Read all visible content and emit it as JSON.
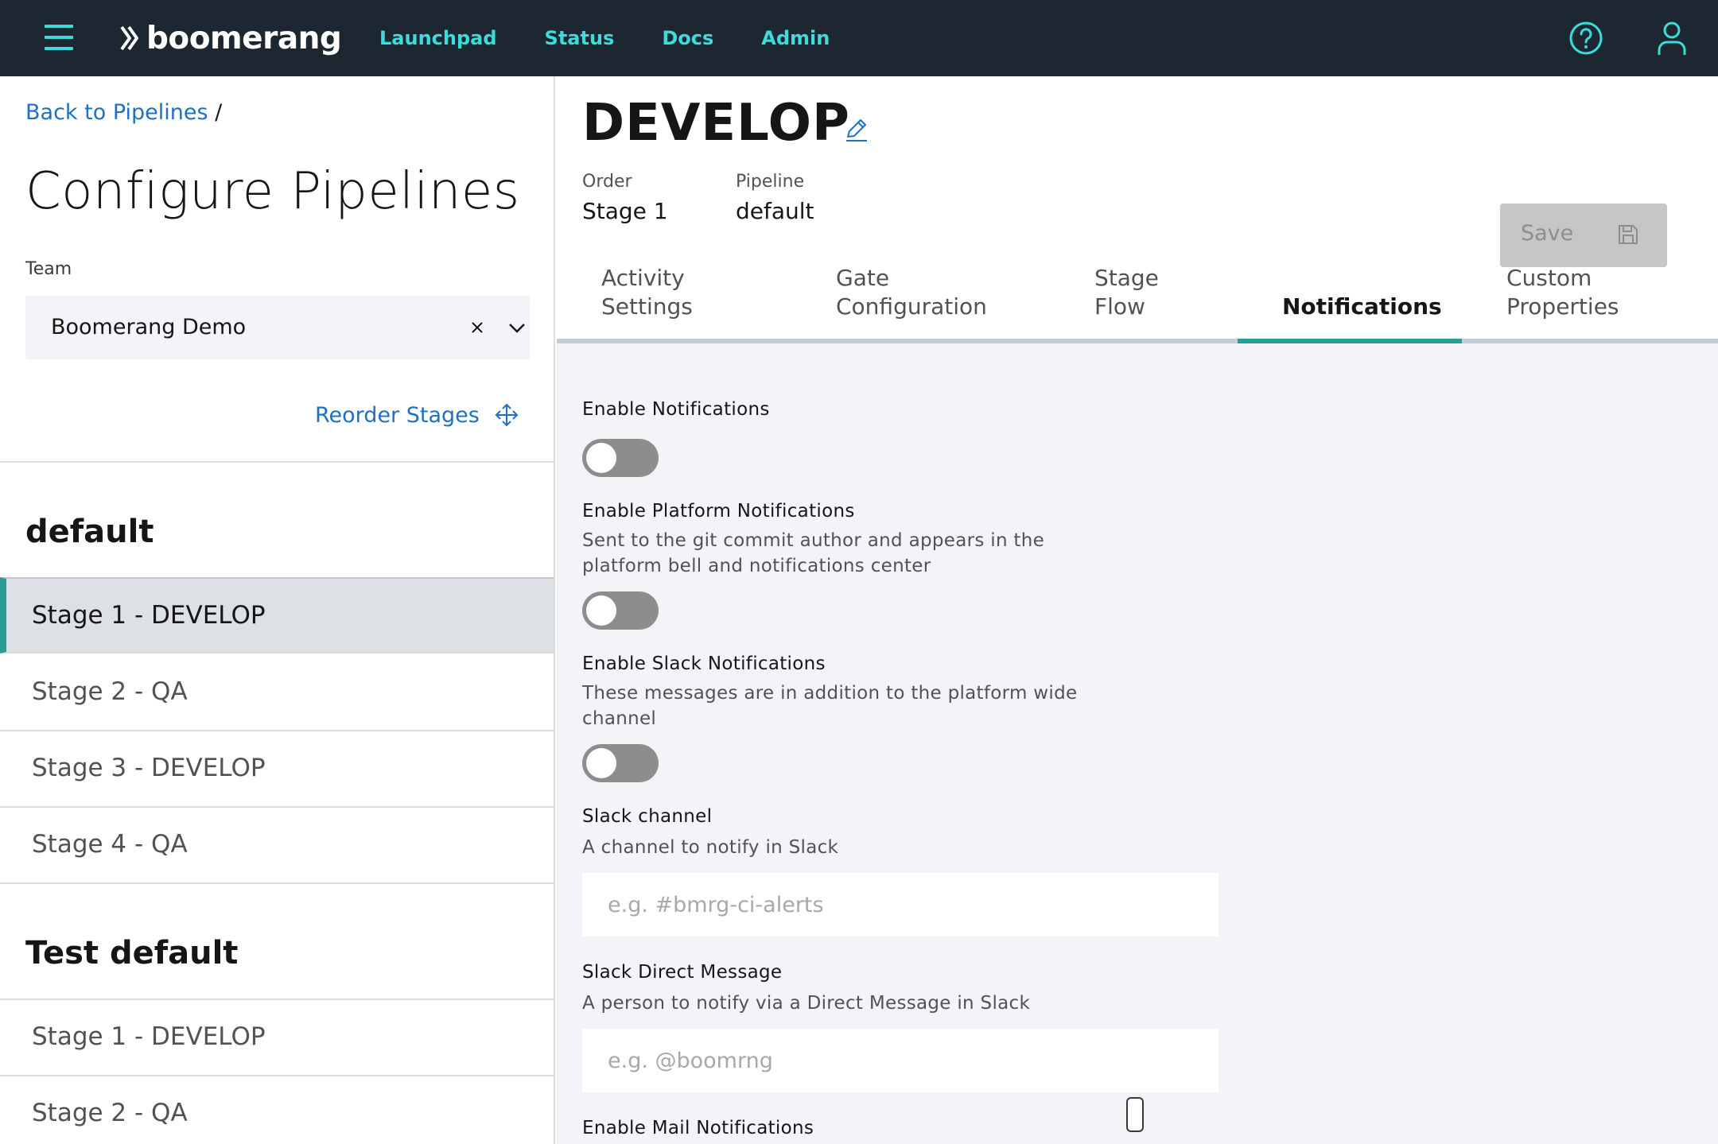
{
  "nav": {
    "brand": "boomerang",
    "links": [
      "Launchpad",
      "Status",
      "Docs",
      "Admin"
    ],
    "icons": {
      "menu": "hamburger-menu-icon",
      "help": "help-icon",
      "user": "user-icon"
    },
    "colors": {
      "bar": "#1c2731",
      "accent": "#3ddbd9"
    }
  },
  "left": {
    "breadcrumb": {
      "link": "Back to Pipelines",
      "sep": "/"
    },
    "title": "Configure Pipelines",
    "team": {
      "label": "Team",
      "value": "Boomerang Demo"
    },
    "reorder_label": "Reorder Stages",
    "groups": [
      {
        "name": "default",
        "stages": [
          "Stage 1 - DEVELOP",
          "Stage 2 - QA",
          "Stage 3 - DEVELOP",
          "Stage 4 - QA"
        ]
      },
      {
        "name": "Test default",
        "stages": [
          "Stage 1 - DEVELOP",
          "Stage 2 - QA"
        ]
      }
    ],
    "active_stage": "Stage 1 - DEVELOP"
  },
  "right": {
    "title": "DEVELOP",
    "meta": {
      "order_label": "Order",
      "order_value": "Stage 1",
      "pipeline_label": "Pipeline",
      "pipeline_value": "default"
    },
    "save_label": "Save",
    "tabs": [
      {
        "line1": "Activity",
        "line2": "Settings"
      },
      {
        "line1": "Gate",
        "line2": "Configuration"
      },
      {
        "line1": "Stage",
        "line2": "Flow"
      },
      {
        "line1": "",
        "line2": "Notifications"
      },
      {
        "line1": "Custom",
        "line2": "Properties"
      }
    ],
    "active_tab": "Notifications",
    "notifications": {
      "enable": {
        "label": "Enable Notifications",
        "on": false
      },
      "platform": {
        "label": "Enable Platform Notifications",
        "help1": "Sent to the git commit author and appears in the",
        "help2": "platform bell and notifications center",
        "on": false
      },
      "slack": {
        "label": "Enable Slack Notifications",
        "help1": "These messages are in addition to the platform wide",
        "help2": "channel",
        "on": false
      },
      "slack_channel": {
        "label": "Slack channel",
        "help": "A channel to notify in Slack",
        "placeholder": "e.g. #bmrg-ci-alerts"
      },
      "slack_dm": {
        "label": "Slack Direct Message",
        "help": "A person to notify via a Direct Message in Slack",
        "placeholder": "e.g. @boomrng"
      },
      "mail": {
        "label": "Enable Mail Notifications"
      }
    }
  }
}
